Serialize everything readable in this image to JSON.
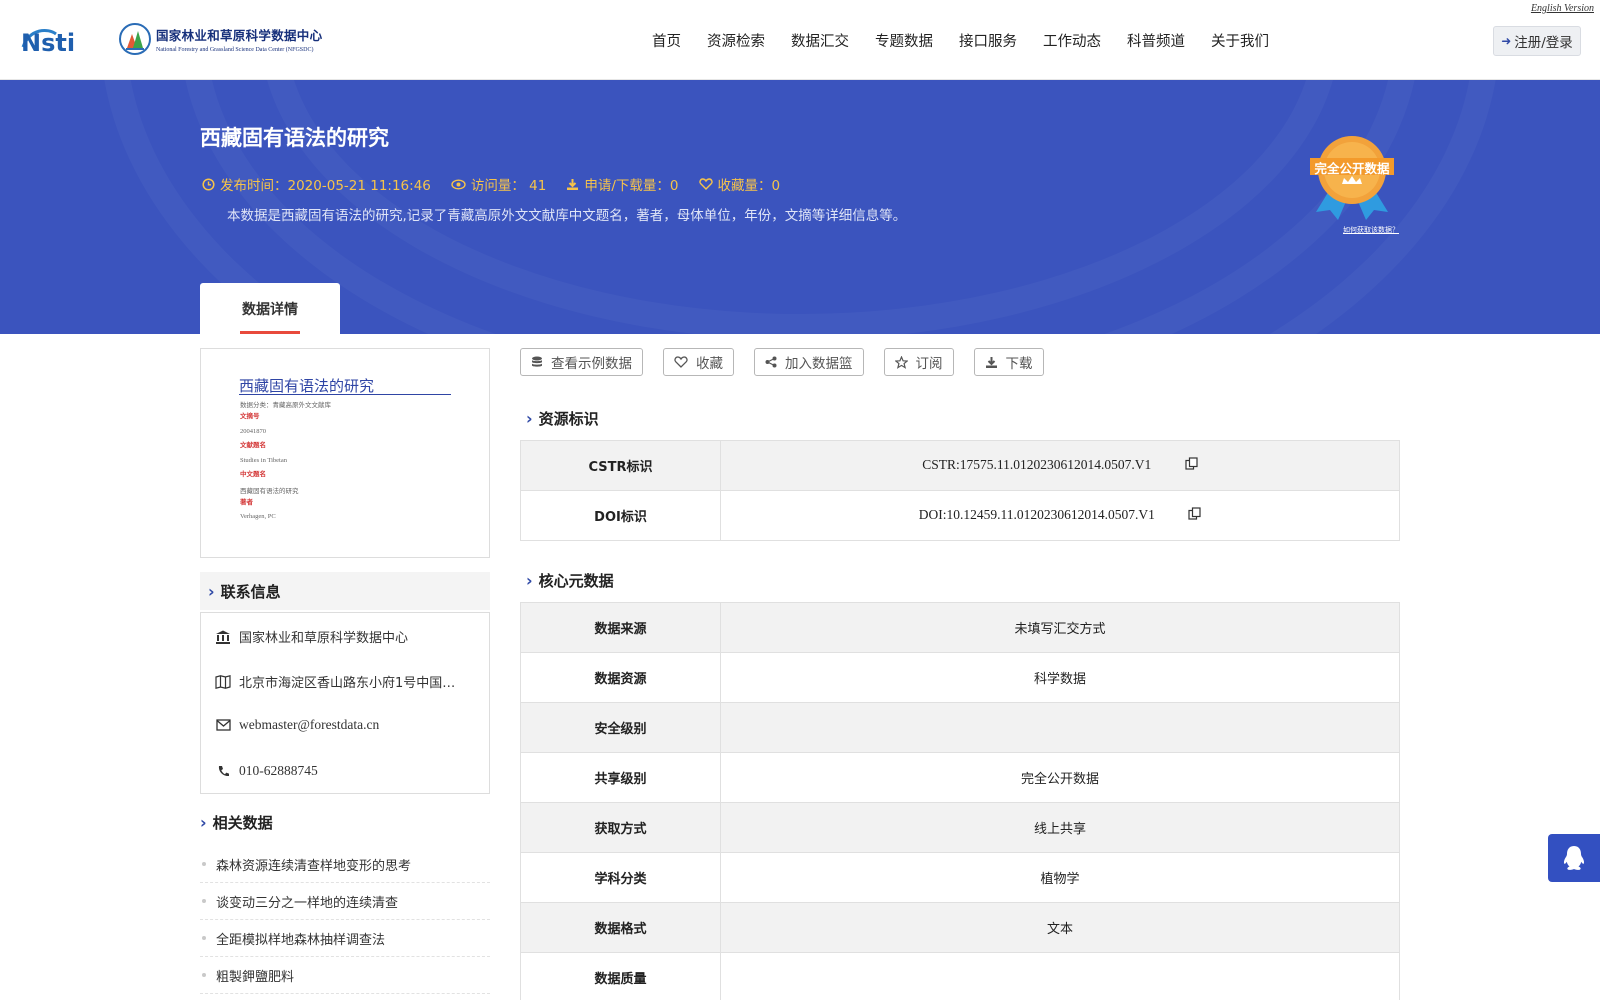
{
  "header": {
    "english_link": "English Version",
    "logo_nsti": "NSTI",
    "logo_cn": "国家林业和草原科学数据中心",
    "logo_en": "National Forestry and Grassland Science Data Center (NFGSDC)",
    "nav": [
      "首页",
      "资源检索",
      "数据汇交",
      "专题数据",
      "接口服务",
      "工作动态",
      "科普频道",
      "关于我们"
    ],
    "login": "注册/登录"
  },
  "banner": {
    "title": "西藏固有语法的研究",
    "publish": "发布时间：2020-05-21 11:16:46",
    "visits": "访问量： 41",
    "downloads": "申请/下载量：0",
    "favorites": "收藏量：0",
    "description": "本数据是西藏固有语法的研究,记录了青藏高原外文文献库中文题名，著者，母体单位，年份，文摘等详细信息等。",
    "badge": "完全公开数据",
    "how_link": "如何获取该数据？",
    "tab": "数据详情",
    "accent_color": "#3b54be",
    "meta_color": "#f6c34a"
  },
  "thumbnail": {
    "title": "西藏固有语法的研究",
    "lines": [
      {
        "text": "数据分类：青藏高原外文文献库",
        "red": false
      },
      {
        "text": "文摘号",
        "red": true
      },
      {
        "text": "20041870",
        "red": false
      },
      {
        "text": "文献题名",
        "red": true
      },
      {
        "text": "Studies in Tibetan",
        "red": false
      },
      {
        "text": "中文题名",
        "red": true
      },
      {
        "text": "西藏固有语法的研究",
        "red": false
      },
      {
        "text": "著者",
        "red": true
      },
      {
        "text": "Verhagen, PC",
        "red": false
      }
    ]
  },
  "contact": {
    "heading": "联系信息",
    "org": "国家林业和草原科学数据中心",
    "address": "北京市海淀区香山路东小府1号中国…",
    "email": "webmaster@forestdata.cn",
    "phone": "010-62888745"
  },
  "related": {
    "heading": "相关数据",
    "items": [
      "森林资源连续清查样地变形的思考",
      "谈变动三分之一样地的连续清查",
      "全距模拟样地森林抽样调查法",
      "粗製鉀鹽肥料"
    ]
  },
  "actions": [
    "查看示例数据",
    "收藏",
    "加入数据篮",
    "订阅",
    "下载"
  ],
  "resource_id": {
    "heading": "资源标识",
    "rows": [
      {
        "key": "CSTR标识",
        "value": "CSTR:17575.11.0120230612014.0507.V1"
      },
      {
        "key": "DOI标识",
        "value": "DOI:10.12459.11.0120230612014.0507.V1"
      }
    ]
  },
  "core_meta": {
    "heading": "核心元数据",
    "rows": [
      {
        "key": "数据来源",
        "value": "未填写汇交方式"
      },
      {
        "key": "数据资源",
        "value": "科学数据"
      },
      {
        "key": "安全级别",
        "value": ""
      },
      {
        "key": "共享级别",
        "value": "完全公开数据"
      },
      {
        "key": "获取方式",
        "value": "线上共享"
      },
      {
        "key": "学科分类",
        "value": "植物学"
      },
      {
        "key": "数据格式",
        "value": "文本"
      },
      {
        "key": "数据质量",
        "value": ""
      }
    ]
  }
}
